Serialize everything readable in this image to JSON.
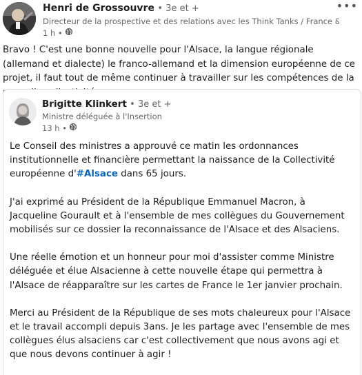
{
  "post": {
    "author_name": "Henri de Grossouvre",
    "degree": "• 3e et +",
    "headline": "Directeur de la prospective et des relations avec les Think Tanks / France & E…",
    "time": "1 h •",
    "more": "•••",
    "text": "Bravo ! C'est une bonne nouvelle pour l'Alsace, la langue régionale (allemand et dialecte) le franco-allemand et la dimension européenne de ce projet, il faut tout de même continuer à travailler sur les compétences de la nouvelle collectivité…"
  },
  "shared": {
    "author_name": "Brigitte Klinkert",
    "degree": "• 3e et +",
    "headline": "Ministre déléguée à l'Insertion",
    "time": "13 h •",
    "p1_before": "Le Conseil des ministres a approuvé ce matin les ordonnances institutionnelle et financière permettant la naissance de la Collectivité européenne d'",
    "hashtag": "#Alsace",
    "p1_after": " dans 65 jours.",
    "p2": "J'ai exprimé au Président de la République Emmanuel Macron, à Jacqueline Gourault et à l'ensemble de mes collègues du Gouvernement mobilisés sur ce dossier la reconnaissance de l'Alsace et des Alsaciens.",
    "p3": "Une réelle émotion et un honneur pour moi d'assister comme Ministre déléguée et élue Alsacienne à cette nouvelle étape qui permettra à l'Alsace de réapparaître sur les cartes de France le 1er janvier prochain.",
    "p4": "Merci au Président de la République de ses mots chaleureux pour l'Alsace et le travail accompli depuis 3ans. Je les partage avec l'ensemble de mes collègues élus alsaciens car c'est collectivement que nous avons agi et que nous devons continuer à agir !"
  },
  "icons": {
    "visibility": "globe-icon",
    "menu": "more-icon"
  }
}
